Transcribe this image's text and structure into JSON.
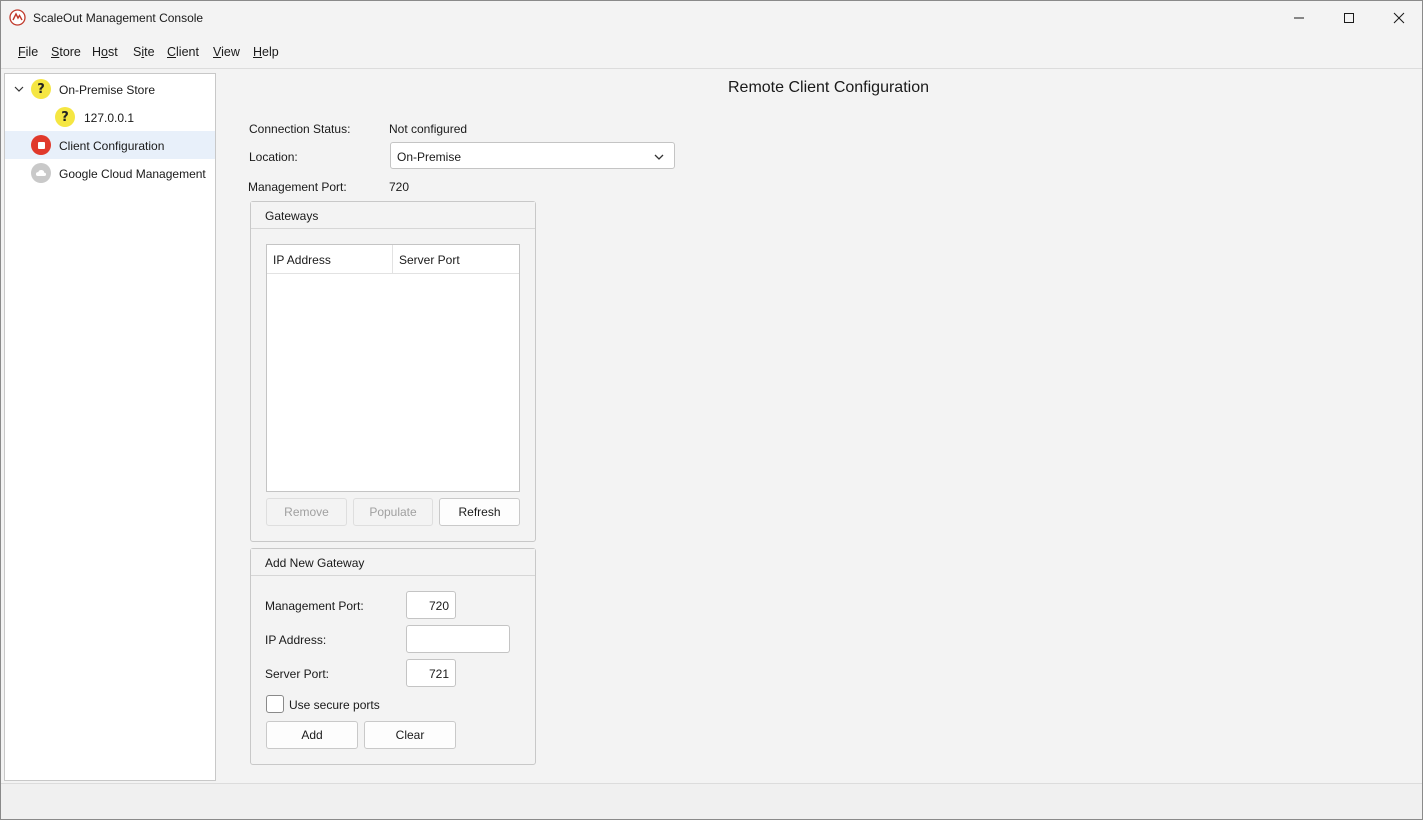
{
  "window": {
    "title": "ScaleOut Management Console",
    "minimize_icon": "minimize-icon",
    "maximize_icon": "maximize-icon",
    "close_icon": "close-icon"
  },
  "menu": {
    "items": [
      {
        "label": "File",
        "accel": "F"
      },
      {
        "label": "Store",
        "accel": "S"
      },
      {
        "label": "Host",
        "accel": "o"
      },
      {
        "label": "Site",
        "accel": "i"
      },
      {
        "label": "Client",
        "accel": "C"
      },
      {
        "label": "View",
        "accel": "V"
      },
      {
        "label": "Help",
        "accel": "H"
      }
    ]
  },
  "tree": {
    "items": [
      {
        "label": "On-Premise Store",
        "icon": "question-icon",
        "expanded": true
      },
      {
        "label": "127.0.0.1",
        "icon": "question-icon"
      },
      {
        "label": "Client Configuration",
        "icon": "stop-icon",
        "selected": true
      },
      {
        "label": "Google Cloud Management",
        "icon": "cloud-icon"
      }
    ]
  },
  "main": {
    "title": "Remote Client Configuration",
    "connection_status_label": "Connection Status:",
    "connection_status_value": "Not configured",
    "location_label": "Location:",
    "location_value": "On-Premise",
    "management_port_label": "Management Port:",
    "management_port_value": "720"
  },
  "gateways": {
    "title": "Gateways",
    "columns": [
      "IP Address",
      "Server Port"
    ],
    "rows": [],
    "remove_label": "Remove",
    "populate_label": "Populate",
    "refresh_label": "Refresh"
  },
  "add_gateway": {
    "title": "Add New Gateway",
    "management_port_label": "Management Port:",
    "management_port_value": "720",
    "ip_address_label": "IP Address:",
    "ip_address_value": "",
    "server_port_label": "Server Port:",
    "server_port_value": "721",
    "secure_ports_label": "Use secure ports",
    "secure_ports_checked": false,
    "add_label": "Add",
    "clear_label": "Clear"
  },
  "colors": {
    "window_bg": "#f3f3f3",
    "selected_row": "#e8f0fa",
    "warning_icon": "#f5e642",
    "stop_icon": "#e0392b"
  }
}
